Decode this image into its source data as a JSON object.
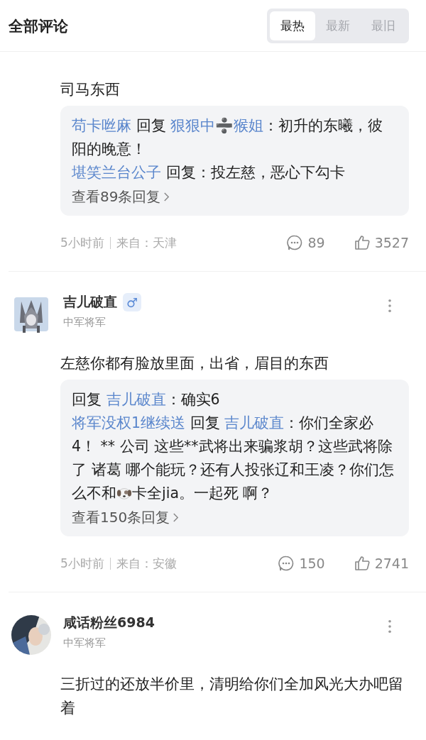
{
  "header": {
    "title": "全部评论",
    "tabs": [
      {
        "label": "最热",
        "selected": true
      },
      {
        "label": "最新",
        "selected": false
      },
      {
        "label": "最旧",
        "selected": false
      }
    ]
  },
  "comments": [
    {
      "body": "司马东西",
      "replies": [
        [
          {
            "kind": "user",
            "text": "苟卡咝麻"
          },
          {
            "kind": "text",
            "text": " 回复 "
          },
          {
            "kind": "user",
            "text": "狠狠中➗猴姐"
          },
          {
            "kind": "text",
            "text": "：初升的东曦，彼阳的晚意！"
          }
        ],
        [
          {
            "kind": "user",
            "text": "堪笑兰台公子"
          },
          {
            "kind": "text",
            "text": " 回复：投左慈，恶心下勾卡"
          }
        ]
      ],
      "more": "查看89条回复",
      "time": "5小时前",
      "location": "来自：天津",
      "reply_count": "89",
      "like_count": "3527"
    },
    {
      "user": {
        "name": "吉儿破直",
        "gender": "♂",
        "rank": "中军将军"
      },
      "body": "左慈你都有脸放里面，出省，眉目的东西",
      "replies": [
        [
          {
            "kind": "text",
            "text": " 回复 "
          },
          {
            "kind": "user",
            "text": "吉儿破直"
          },
          {
            "kind": "text",
            "text": "：确实6"
          }
        ],
        [
          {
            "kind": "user",
            "text": "将军没权1继续送"
          },
          {
            "kind": "text",
            "text": " 回复 "
          },
          {
            "kind": "user",
            "text": "吉儿破直"
          },
          {
            "kind": "text",
            "text": "：你们全家必4！ ** 公司 这些**武将出来骗浆胡？这些武将除了 诸葛 哪个能玩？还有人投张辽和王凌？你们怎么不和"
          },
          {
            "kind": "emoji"
          },
          {
            "kind": "text",
            "text": "卡全jia。一起死 啊？"
          }
        ]
      ],
      "more": "查看150条回复",
      "time": "5小时前",
      "location": "来自：安徽",
      "reply_count": "150",
      "like_count": "2741"
    },
    {
      "user": {
        "name": "咸话粉丝6984",
        "rank": "中军将军"
      },
      "body": "三折过的还放半价里，清明给你们全加风光大办吧留着"
    }
  ]
}
